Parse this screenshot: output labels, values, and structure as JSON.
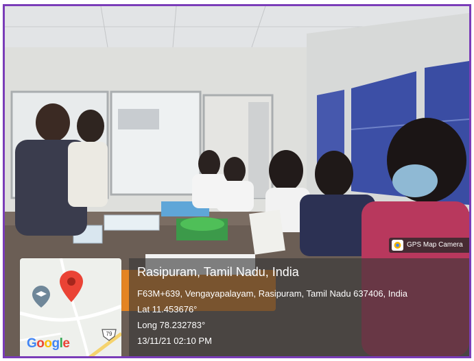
{
  "overlay": {
    "title": "Rasipuram, Tamil Nadu, India",
    "address": "F63M+639, Vengayapalayam, Rasipuram, Tamil Nadu 637406, India",
    "lat": "Lat 11.453676°",
    "long": "Long 78.232783°",
    "datetime": "13/11/21 02:10 PM"
  },
  "badge": {
    "label": "GPS Map Camera",
    "icon": "camera-icon"
  },
  "map": {
    "logo": "Google",
    "road_sign": "79",
    "pin_color": "#ea4335",
    "pin_icon": "map-pin-icon",
    "place_icon": "graduation-cap-icon"
  },
  "colors": {
    "frame": "#7a3cb8",
    "overlay": "#373737"
  }
}
